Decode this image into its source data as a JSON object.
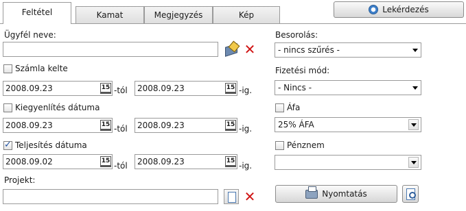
{
  "tabs": [
    {
      "label": "Feltétel",
      "active": true
    },
    {
      "label": "Kamat"
    },
    {
      "label": "Megjegyzés"
    },
    {
      "label": "Kép"
    }
  ],
  "query_button": {
    "label": "Lekérdezés",
    "icon": "gear-icon"
  },
  "client": {
    "label": "Ügyfél neve:",
    "value": "",
    "lookup_icon": "lookup-icon",
    "clear_icon": "close-icon"
  },
  "dates": [
    {
      "label": "Számla kelte",
      "checked": false,
      "from": "2008.09.23",
      "to": "2008.09.23",
      "from_suffix": "-tól",
      "to_suffix": "-ig."
    },
    {
      "label": "Kiegyenlítés dátuma",
      "checked": false,
      "from": "2008.09.23",
      "to": "2008.09.23",
      "from_suffix": "-tól",
      "to_suffix": "-ig."
    },
    {
      "label": "Teljesítés dátuma",
      "checked": true,
      "from": "2008.09.02",
      "to": "2008.09.23",
      "from_suffix": "-tól",
      "to_suffix": "-ig."
    }
  ],
  "calendar_glyph": "15",
  "project": {
    "label": "Projekt:",
    "value": ""
  },
  "classification": {
    "label": "Besorolás:",
    "value": "- nincs szűrés -"
  },
  "payment": {
    "label": "Fizetési mód:",
    "value": "- Nincs -"
  },
  "vat": {
    "label": "Áfa",
    "checked": false,
    "value": "25% ÁFA"
  },
  "currency": {
    "label": "Pénznem",
    "checked": false,
    "value": ""
  },
  "print_button": {
    "label": "Nyomtatás"
  },
  "colors": {
    "accent": "#3d7fc9",
    "delete_red": "#d01414"
  }
}
